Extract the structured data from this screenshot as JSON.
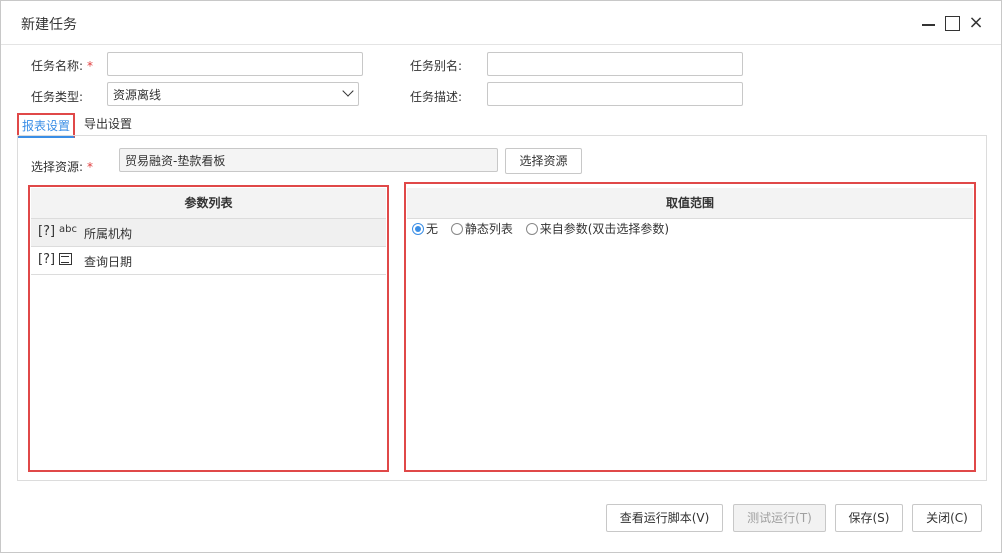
{
  "window": {
    "title": "新建任务",
    "controls": {
      "minimize": "minimize-icon",
      "maximize": "maximize-icon",
      "close": "×"
    }
  },
  "form": {
    "task_name_label": "任务名称:",
    "task_name_required": "*",
    "task_name_value": "",
    "task_alias_label": "任务别名:",
    "task_alias_value": "",
    "task_type_label": "任务类型:",
    "task_type_value": "资源离线",
    "task_desc_label": "任务描述:",
    "task_desc_value": ""
  },
  "tabs": [
    {
      "label": "报表设置",
      "active": true
    },
    {
      "label": "导出设置",
      "active": false
    }
  ],
  "resource": {
    "label": "选择资源:",
    "required": "*",
    "value": "贸易融资-垫款看板",
    "button": "选择资源"
  },
  "param_list": {
    "header": "参数列表",
    "rows": [
      {
        "flag": "[?]",
        "type_icon": "abc",
        "name": "所属机构"
      },
      {
        "flag": "[?]",
        "type_icon": "calendar-icon",
        "name": "查询日期"
      }
    ]
  },
  "value_range": {
    "header": "取值范围",
    "options": [
      {
        "label": "无",
        "selected": true
      },
      {
        "label": "静态列表",
        "selected": false
      },
      {
        "label": "来自参数(双击选择参数)",
        "selected": false
      }
    ]
  },
  "footer": {
    "view_script": "查看运行脚本(V)",
    "test_run": "测试运行(T)",
    "save": "保存(S)",
    "close": "关闭(C)"
  },
  "colors": {
    "accent": "#3a8ee6",
    "highlight": "#e04848",
    "required": "#e03c3c"
  }
}
